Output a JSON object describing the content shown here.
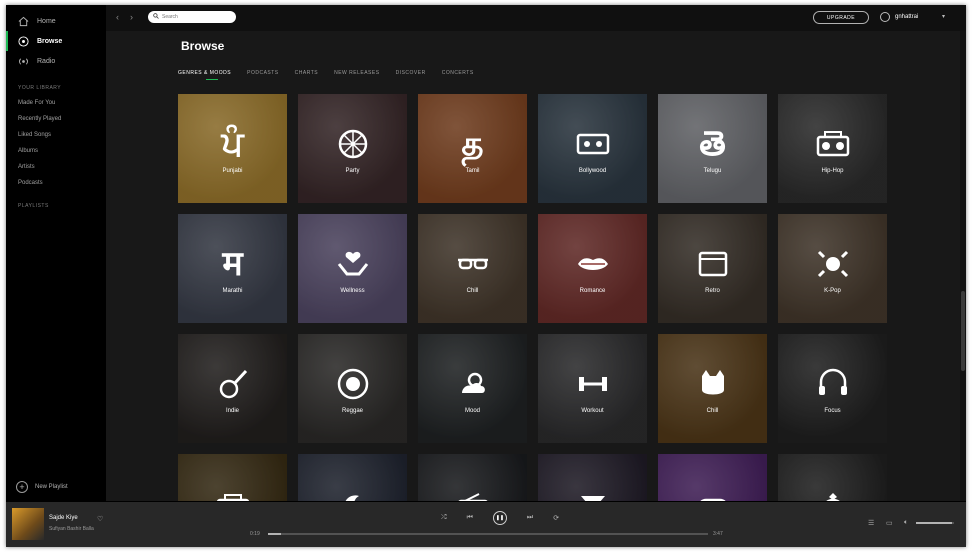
{
  "sidebar": {
    "nav": [
      {
        "label": "Home",
        "icon": "home-icon"
      },
      {
        "label": "Browse",
        "icon": "browse-icon",
        "active": true
      },
      {
        "label": "Radio",
        "icon": "radio-icon"
      }
    ],
    "library_heading": "YOUR LIBRARY",
    "library_items": [
      "Made For You",
      "Recently Played",
      "Liked Songs",
      "Albums",
      "Artists",
      "Podcasts"
    ],
    "playlists_heading": "PLAYLISTS",
    "new_playlist": "New Playlist"
  },
  "topbar": {
    "search_placeholder": "Search",
    "upgrade": "UPGRADE",
    "username": "gnhattrai"
  },
  "main": {
    "title": "Browse",
    "tabs": [
      {
        "label": "GENRES & MOODS",
        "active": true
      },
      {
        "label": "PODCASTS"
      },
      {
        "label": "CHARTS"
      },
      {
        "label": "NEW RELEASES"
      },
      {
        "label": "DISCOVER"
      },
      {
        "label": "CONCERTS"
      }
    ],
    "tiles": [
      {
        "label": "Punjabi",
        "icon": "punjabi-script-icon",
        "glyph": "ਪੰ",
        "bg": "#c79a3a"
      },
      {
        "label": "Party",
        "icon": "disco-ball-icon",
        "glyph": "",
        "bg": "#4a3436"
      },
      {
        "label": "Tamil",
        "icon": "tamil-script-icon",
        "glyph": "த",
        "bg": "#a0562a"
      },
      {
        "label": "Bollywood",
        "icon": "cassette-icon",
        "glyph": "",
        "bg": "#3a4a58"
      },
      {
        "label": "Telugu",
        "icon": "telugu-script-icon",
        "glyph": "తె",
        "bg": "#8a8c92"
      },
      {
        "label": "Hip-Hop",
        "icon": "boombox-icon",
        "glyph": "",
        "bg": "#3a3a3a"
      },
      {
        "label": "Marathi",
        "icon": "marathi-script-icon",
        "glyph": "म",
        "bg": "#4a5060"
      },
      {
        "label": "Wellness",
        "icon": "hands-heart-icon",
        "glyph": "",
        "bg": "#6b5f86"
      },
      {
        "label": "Chill",
        "icon": "sunglasses-icon",
        "glyph": "",
        "bg": "#5a4a3a"
      },
      {
        "label": "Romance",
        "icon": "lips-icon",
        "glyph": "",
        "bg": "#8a3a36"
      },
      {
        "label": "Retro",
        "icon": "film-icon",
        "glyph": "",
        "bg": "#4a4036"
      },
      {
        "label": "K-Pop",
        "icon": "korea-flag-icon",
        "glyph": "",
        "bg": "#5a4a3a"
      },
      {
        "label": "Indie",
        "icon": "guitar-hand-icon",
        "glyph": "",
        "bg": "#2e2a28"
      },
      {
        "label": "Reggae",
        "icon": "lion-icon",
        "glyph": "",
        "bg": "#3a3836"
      },
      {
        "label": "Mood",
        "icon": "cloud-sun-icon",
        "glyph": "",
        "bg": "#2a2e30"
      },
      {
        "label": "Workout",
        "icon": "dumbbell-icon",
        "glyph": "",
        "bg": "#3a3a3c"
      },
      {
        "label": "Chill",
        "icon": "cat-icon",
        "glyph": "",
        "bg": "#6a4a20"
      },
      {
        "label": "Focus",
        "icon": "headphones-icon",
        "glyph": "",
        "bg": "#2a2a2a"
      },
      {
        "label": "",
        "icon": "boombox-icon",
        "glyph": "",
        "bg": "#4a3a1a"
      },
      {
        "label": "",
        "icon": "moon-icon",
        "glyph": "",
        "bg": "#2a3040"
      },
      {
        "label": "",
        "icon": "radio-icon",
        "glyph": "",
        "bg": "#222428"
      },
      {
        "label": "",
        "icon": "cocktail-icon",
        "glyph": "",
        "bg": "#2a2434"
      },
      {
        "label": "",
        "icon": "gamepad-icon",
        "glyph": "",
        "bg": "#5a2a7a"
      },
      {
        "label": "",
        "icon": "ring-icon",
        "glyph": "",
        "bg": "#2a2a2a"
      }
    ]
  },
  "player": {
    "track_title": "Sajde Kiye",
    "track_artist": "Sufiyan Bashir Balla",
    "time_elapsed": "0:19",
    "time_total": "3:47",
    "progress": 0.03,
    "volume": 0.95
  },
  "colors": {
    "accent": "#1db954",
    "background": "#181818",
    "sidebar": "#000000",
    "player": "#282828"
  }
}
